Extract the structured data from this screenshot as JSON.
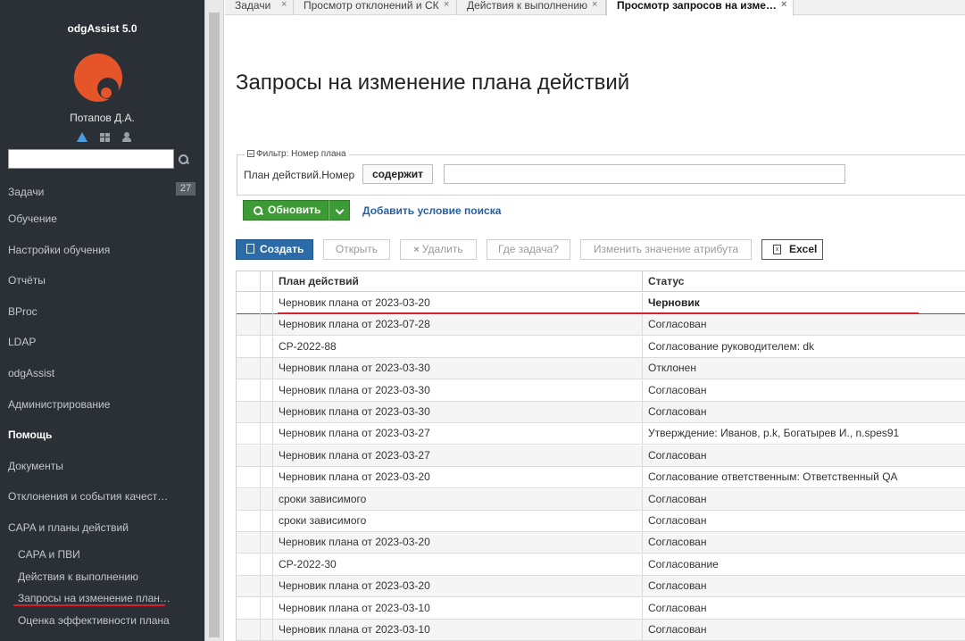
{
  "sidebar": {
    "app_title": "odgAssist 5.0",
    "user_name": "Потапов Д.А.",
    "search_placeholder": "",
    "tasks_badge": "27",
    "items": [
      {
        "label": "Задачи",
        "bold": false
      },
      {
        "label": "Обучение",
        "bold": false
      },
      {
        "label": "Настройки обучения",
        "bold": false
      },
      {
        "label": "Отчёты",
        "bold": false
      },
      {
        "label": "BProc",
        "bold": false
      },
      {
        "label": "LDAP",
        "bold": false
      },
      {
        "label": "odgAssist",
        "bold": false
      },
      {
        "label": "Администрирование",
        "bold": false
      },
      {
        "label": "Помощь",
        "bold": true
      },
      {
        "label": "Документы",
        "bold": false
      },
      {
        "label": "Отклонения и события качест…",
        "bold": false
      },
      {
        "label": "CAPA и планы действий",
        "bold": false
      }
    ],
    "sub_items": [
      {
        "label": "CAPA и ПВИ"
      },
      {
        "label": "Действия к выполнению"
      },
      {
        "label": "Запросы на изменение план…"
      },
      {
        "label": "Оценка эффективности плана"
      }
    ]
  },
  "tabs": [
    {
      "label": "Задачи",
      "active": false
    },
    {
      "label": "Просмотр отклонений и СК",
      "active": false
    },
    {
      "label": "Действия к выполнению",
      "active": false
    },
    {
      "label": "Просмотр запросов на изме…",
      "active": true
    }
  ],
  "tab_close_glyph": "×",
  "page": {
    "title": "Запросы на изменение плана действий"
  },
  "filter": {
    "legend": "Фильтр: Номер плана",
    "field_label": "План действий.Номер",
    "operator": "содержит",
    "value": "",
    "refresh_label": "Обновить",
    "add_condition_label": "Добавить условие поиска"
  },
  "toolbar": {
    "create": "Создать",
    "open": "Открыть",
    "delete": "Удалить",
    "where_task": "Где задача?",
    "change_attr": "Изменить значение атрибута",
    "excel": "Excel",
    "excel_icon_glyph": "x"
  },
  "grid": {
    "columns": [
      "План действий",
      "Статус"
    ],
    "rows": [
      {
        "plan": "Черновик плана от 2023-03-20",
        "status": "Черновик",
        "selected": true
      },
      {
        "plan": "Черновик плана от 2023-07-28",
        "status": "Согласован"
      },
      {
        "plan": "CP-2022-88",
        "status": "Согласование руководителем: dk"
      },
      {
        "plan": "Черновик плана от 2023-03-30",
        "status": "Отклонен"
      },
      {
        "plan": "Черновик плана от 2023-03-30",
        "status": "Согласован"
      },
      {
        "plan": "Черновик плана от 2023-03-30",
        "status": "Согласован"
      },
      {
        "plan": "Черновик плана от 2023-03-27",
        "status": "Утверждение: Иванов, p.k, Богатырев И., n.spes91"
      },
      {
        "plan": "Черновик плана от 2023-03-27",
        "status": "Согласован"
      },
      {
        "plan": "Черновик плана от 2023-03-20",
        "status": "Согласование ответственным: Ответственный QA"
      },
      {
        "plan": "сроки зависимого",
        "status": "Согласован"
      },
      {
        "plan": "сроки зависимого",
        "status": "Согласован"
      },
      {
        "plan": "Черновик плана от 2023-03-20",
        "status": "Согласован"
      },
      {
        "plan": "CP-2022-30",
        "status": "Согласование"
      },
      {
        "plan": "Черновик плана от 2023-03-20",
        "status": "Согласован"
      },
      {
        "plan": "Черновик плана от 2023-03-10",
        "status": "Согласован"
      },
      {
        "plan": "Черновик плана от 2023-03-10",
        "status": "Согласован"
      }
    ]
  },
  "colors": {
    "sidebar_bg": "#2b2f36",
    "logo": "#e6552a",
    "primary": "#2b6ca8",
    "success": "#3d9b35",
    "annotation": "#d9202a"
  }
}
